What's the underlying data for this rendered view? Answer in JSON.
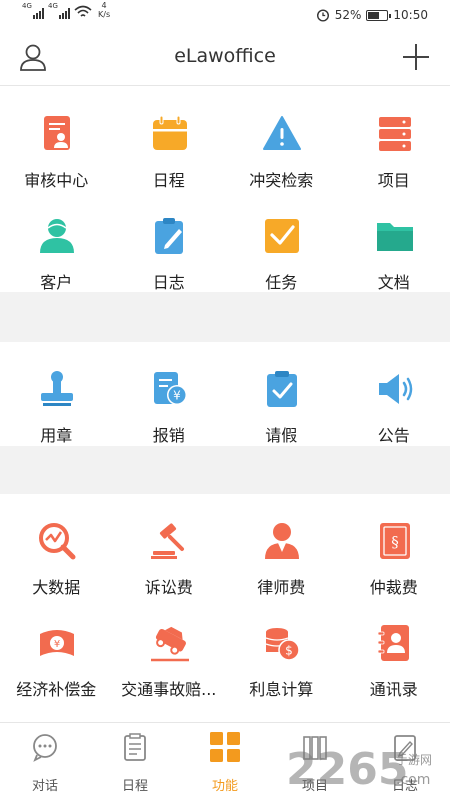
{
  "status_bar": {
    "signal1": "4G",
    "signal2": "4G",
    "speed_num": "4",
    "speed_unit": "K/s",
    "battery": "52%",
    "time": "10:50"
  },
  "header": {
    "title": "eLawoffice"
  },
  "sections": [
    {
      "items": [
        {
          "label": "审核中心",
          "icon": "audit-center-icon",
          "color": "#f26b4f"
        },
        {
          "label": "日程",
          "icon": "calendar-icon",
          "color": "#f7a928"
        },
        {
          "label": "冲突检索",
          "icon": "warning-icon",
          "color": "#4aa3e0"
        },
        {
          "label": "项目",
          "icon": "project-stack-icon",
          "color": "#f26b4f"
        },
        {
          "label": "客户",
          "icon": "clients-icon",
          "color": "#2fc2a3"
        },
        {
          "label": "日志",
          "icon": "log-clipboard-icon",
          "color": "#4aa3e0"
        },
        {
          "label": "任务",
          "icon": "task-check-icon",
          "color": "#f7a928"
        },
        {
          "label": "文档",
          "icon": "folder-icon",
          "color": "#2fc2a3"
        }
      ]
    },
    {
      "items": [
        {
          "label": "用章",
          "icon": "stamp-icon",
          "color": "#4aa3e0"
        },
        {
          "label": "报销",
          "icon": "reimburse-icon",
          "color": "#4aa3e0"
        },
        {
          "label": "请假",
          "icon": "leave-clipboard-icon",
          "color": "#4aa3e0"
        },
        {
          "label": "公告",
          "icon": "speaker-icon",
          "color": "#4aa3e0"
        }
      ]
    },
    {
      "items": [
        {
          "label": "大数据",
          "icon": "big-data-icon",
          "color": "#f26b4f"
        },
        {
          "label": "诉讼费",
          "icon": "gavel-icon",
          "color": "#f26b4f"
        },
        {
          "label": "律师费",
          "icon": "lawyer-icon",
          "color": "#f26b4f"
        },
        {
          "label": "仲裁费",
          "icon": "law-book-icon",
          "color": "#f26b4f"
        },
        {
          "label": "经济补偿金",
          "icon": "compensation-icon",
          "color": "#f26b4f"
        },
        {
          "label": "交通事故赔...",
          "icon": "car-accident-icon",
          "color": "#f26b4f"
        },
        {
          "label": "利息计算",
          "icon": "coins-icon",
          "color": "#f26b4f"
        },
        {
          "label": "通讯录",
          "icon": "contacts-icon",
          "color": "#f26b4f"
        }
      ]
    }
  ],
  "bottom_nav": [
    {
      "label": "对话",
      "icon": "chat-icon",
      "active": false
    },
    {
      "label": "日程",
      "icon": "schedule-icon",
      "active": false
    },
    {
      "label": "功能",
      "icon": "grid-icon",
      "active": true
    },
    {
      "label": "项目",
      "icon": "project-icon",
      "active": false
    },
    {
      "label": "日志",
      "icon": "log-icon",
      "active": false
    }
  ],
  "watermark": {
    "number": "2265",
    "suffix": ".com",
    "tagline": "手游网"
  },
  "colors": {
    "accent": "#f39a1e",
    "red": "#f26b4f",
    "blue": "#4aa3e0",
    "green": "#2fc2a3",
    "yellow": "#f7a928"
  }
}
